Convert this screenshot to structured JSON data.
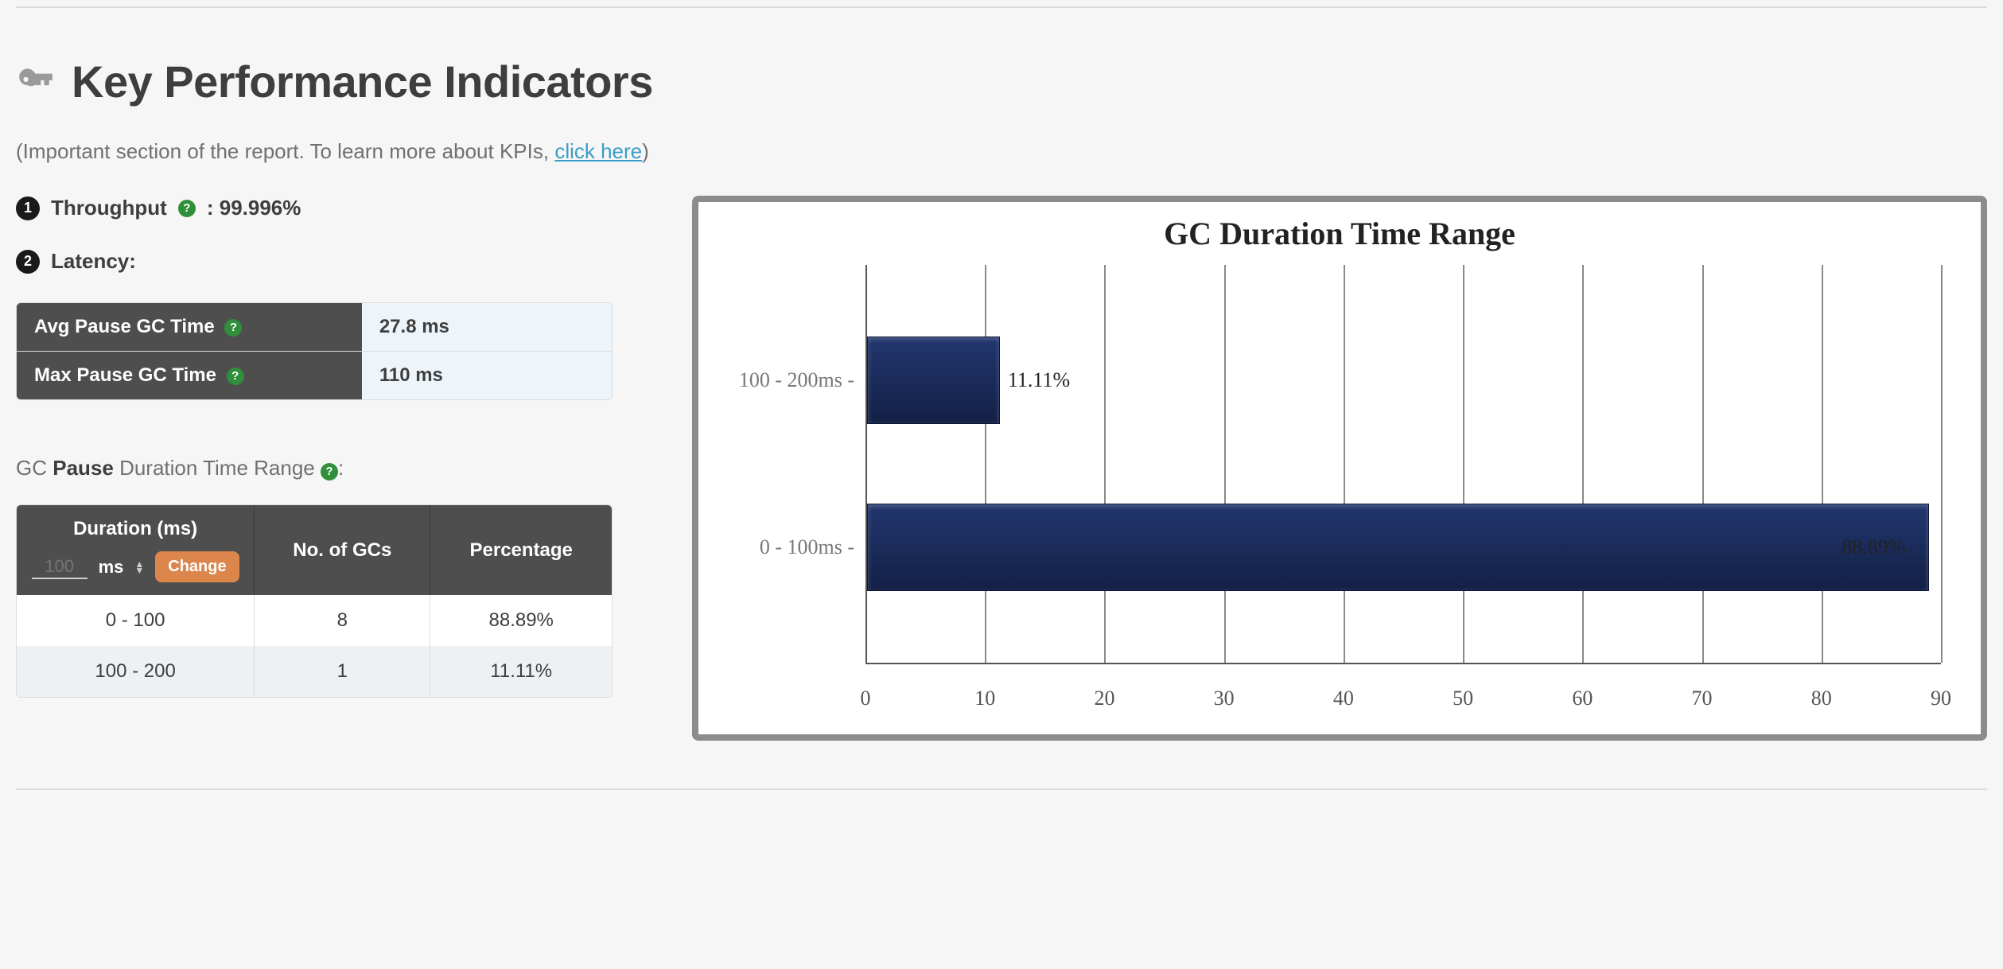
{
  "section_title": "Key Performance Indicators",
  "subtitle_pre": "(Important section of the report. To learn more about KPIs, ",
  "subtitle_link": "click here",
  "subtitle_post": ")",
  "kpi1": {
    "label": "Throughput",
    "value": "99.996%"
  },
  "kpi2": {
    "label": "Latency:"
  },
  "latency_table": {
    "rows": [
      {
        "label": "Avg Pause GC Time",
        "value": "27.8 ms"
      },
      {
        "label": "Max Pause GC Time",
        "value": "110 ms"
      }
    ]
  },
  "range_title_pre": "GC ",
  "range_title_bold": "Pause",
  "range_title_post": " Duration Time Range",
  "range_header": {
    "duration": "Duration (ms)",
    "gcs": "No. of GCs",
    "pct": "Percentage",
    "input_placeholder": "100",
    "ms_label": "ms",
    "change": "Change"
  },
  "range_rows": [
    {
      "duration": "0 - 100",
      "gcs": "8",
      "pct": "88.89%"
    },
    {
      "duration": "100 - 200",
      "gcs": "1",
      "pct": "11.11%"
    }
  ],
  "chart_data": {
    "type": "bar",
    "orientation": "horizontal",
    "title": "GC Duration Time Range",
    "categories": [
      "100 - 200ms",
      "0 - 100ms"
    ],
    "values": [
      11.11,
      88.89
    ],
    "value_labels": [
      "11.11%",
      "88.89%"
    ],
    "xlim": [
      0,
      90
    ],
    "xticks": [
      0,
      10,
      20,
      30,
      40,
      50,
      60,
      70,
      80,
      90
    ],
    "xlabel": "",
    "ylabel": ""
  }
}
